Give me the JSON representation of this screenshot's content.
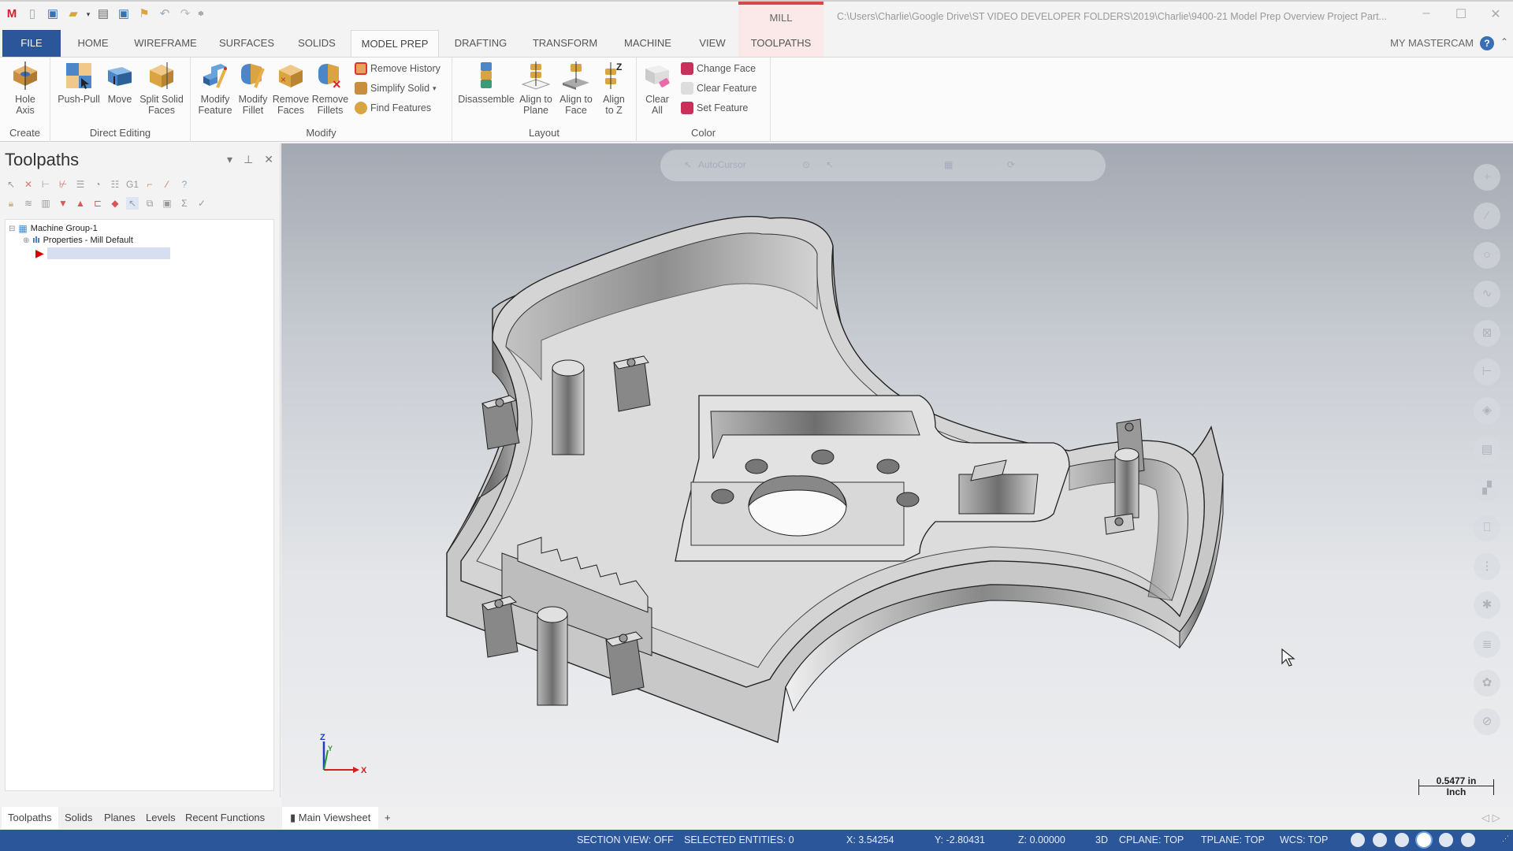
{
  "app": {
    "logo": "mastercam-logo-icon",
    "context_tab": "MILL",
    "file_path": "C:\\Users\\Charlie\\Google Drive\\ST VIDEO DEVELOPER FOLDERS\\2019\\Charlie\\9400-21 Model Prep Overview Project Part...",
    "window_controls": [
      "minimize",
      "maximize",
      "close"
    ]
  },
  "qat": [
    "new-file-icon",
    "save-icon",
    "open-icon",
    "print-icon",
    "save-as-icon",
    "pin-icon",
    "undo-icon",
    "redo-icon",
    "customize-icon"
  ],
  "tabs": [
    {
      "label": "FILE"
    },
    {
      "label": "HOME"
    },
    {
      "label": "WIREFRAME"
    },
    {
      "label": "SURFACES"
    },
    {
      "label": "SOLIDS"
    },
    {
      "label": "MODEL PREP",
      "active": true
    },
    {
      "label": "DRAFTING"
    },
    {
      "label": "TRANSFORM"
    },
    {
      "label": "MACHINE"
    },
    {
      "label": "VIEW"
    },
    {
      "label": "TOOLPATHS"
    }
  ],
  "my_mastercam": "MY MASTERCAM",
  "ribbon": {
    "groups": [
      {
        "label": "Create",
        "buttons": [
          {
            "label": "Hole Axis"
          }
        ]
      },
      {
        "label": "Direct Editing",
        "buttons": [
          {
            "label": "Push-Pull"
          },
          {
            "label": "Move"
          },
          {
            "label": "Split Solid Faces"
          }
        ]
      },
      {
        "label": "Modify",
        "buttons": [
          {
            "label": "Modify Feature"
          },
          {
            "label": "Modify Fillet"
          },
          {
            "label": "Remove Faces"
          },
          {
            "label": "Remove Fillets"
          }
        ],
        "small": [
          {
            "label": "Remove History"
          },
          {
            "label": "Simplify Solid"
          },
          {
            "label": "Find Features"
          }
        ]
      },
      {
        "label": "Layout",
        "buttons": [
          {
            "label": "Disassemble"
          },
          {
            "label": "Align to Plane"
          },
          {
            "label": "Align to Face"
          },
          {
            "label": "Align to Z"
          }
        ]
      },
      {
        "label": "Color",
        "buttons": [
          {
            "label": "Clear All"
          }
        ],
        "small": [
          {
            "label": "Change Face"
          },
          {
            "label": "Clear Feature"
          },
          {
            "label": "Set Feature"
          }
        ]
      }
    ]
  },
  "panel": {
    "title": "Toolpaths",
    "tree": [
      {
        "label": "Machine Group-1"
      },
      {
        "label": "Properties - Mill Default"
      },
      {
        "label": ""
      }
    ]
  },
  "bottom_tabs": {
    "panel": [
      "Toolpaths",
      "Solids",
      "Planes",
      "Levels",
      "Recent Functions"
    ],
    "viewsheet": "Main Viewsheet",
    "add": "+"
  },
  "viewport": {
    "selection_bar_mode": "AutoCursor",
    "scale": {
      "value": "0.5477 in",
      "unit": "Inch"
    },
    "axes": {
      "z": "Z",
      "y": "Y",
      "x": "X"
    }
  },
  "status": {
    "section_view": "SECTION VIEW: OFF",
    "selected": "SELECTED ENTITIES: 0",
    "x": "X:  3.54254",
    "y": "Y:  -2.80431",
    "z": "Z:  0.00000",
    "mode": "3D",
    "cplane": "CPLANE: TOP",
    "tplane": "TPLANE: TOP",
    "wcs": "WCS: TOP"
  }
}
